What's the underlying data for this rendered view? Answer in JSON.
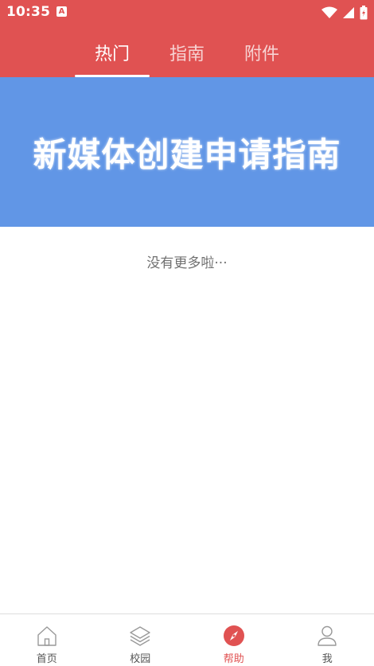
{
  "status_bar": {
    "time": "10:35",
    "notif_icon_letter": "A"
  },
  "tabs": [
    {
      "label": "热门",
      "active": true
    },
    {
      "label": "指南",
      "active": false
    },
    {
      "label": "附件",
      "active": false
    }
  ],
  "banner": {
    "title": "新媒体创建申请指南",
    "bg_color": "#6196e6"
  },
  "list": {
    "empty_text": "没有更多啦···"
  },
  "bottom_nav": [
    {
      "label": "首页",
      "icon": "home-icon",
      "active": false
    },
    {
      "label": "校园",
      "icon": "layers-icon",
      "active": false
    },
    {
      "label": "帮助",
      "icon": "compass-icon",
      "active": true
    },
    {
      "label": "我",
      "icon": "user-icon",
      "active": false
    }
  ],
  "colors": {
    "primary": "#e05252",
    "banner": "#6196e6"
  }
}
